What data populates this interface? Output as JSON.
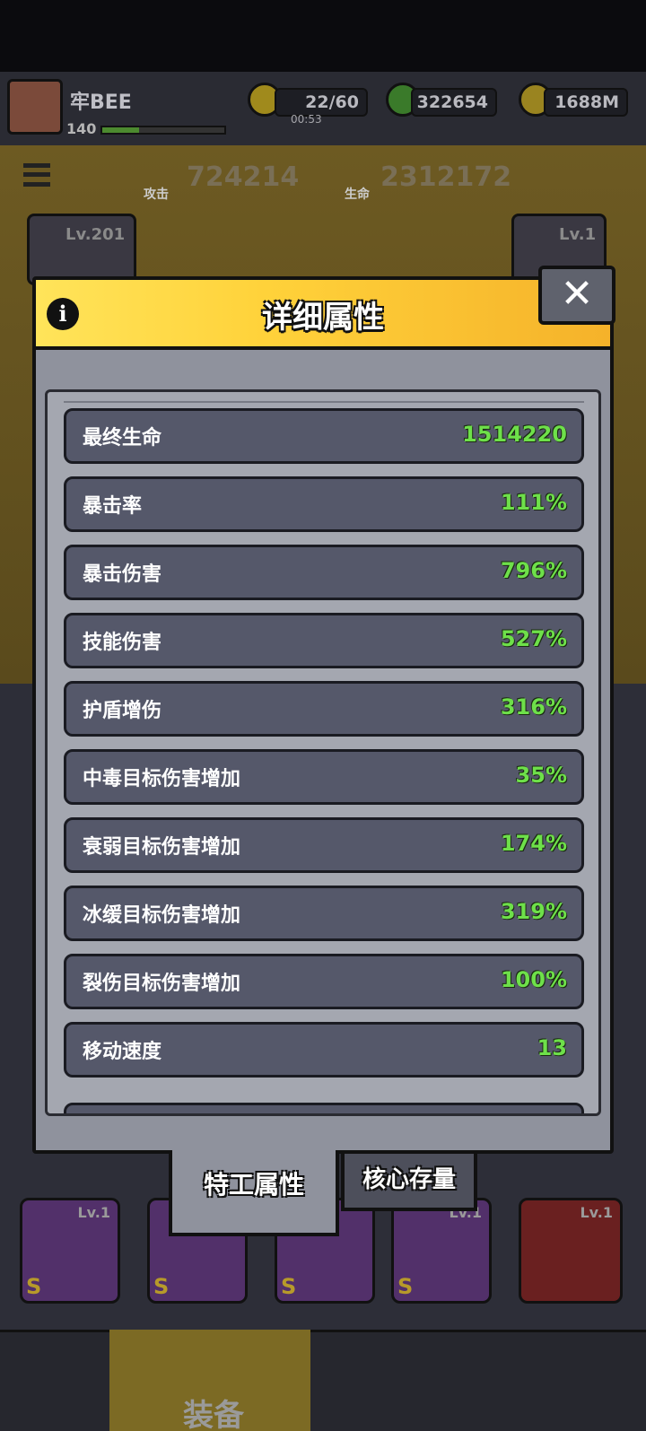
{
  "status": {
    "player_name": "牢BEE",
    "player_level": "140",
    "energy": "22/60",
    "energy_timer": "00:53",
    "gems": "322654",
    "gold": "1688M"
  },
  "power": {
    "attack_label": "攻击",
    "attack_value": "724214",
    "hp_label": "生命",
    "hp_value": "2312172"
  },
  "cards": {
    "left_lv": "Lv.201",
    "right_lv": "Lv.1"
  },
  "slots": [
    {
      "lv": "Lv.1",
      "grade": "S"
    },
    {
      "lv": "",
      "grade": "S"
    },
    {
      "lv": "",
      "grade": "S"
    },
    {
      "lv": "Lv.1",
      "grade": "S"
    },
    {
      "lv": "Lv.1",
      "grade": ""
    }
  ],
  "nav": {
    "active_label": "装备"
  },
  "modal": {
    "title": "详细属性",
    "close_glyph": "✕",
    "info_glyph": "i",
    "stats": [
      {
        "label": "最终生命",
        "value": "1514220"
      },
      {
        "label": "暴击率",
        "value": "111%"
      },
      {
        "label": "暴击伤害",
        "value": "796%"
      },
      {
        "label": "技能伤害",
        "value": "527%"
      },
      {
        "label": "护盾增伤",
        "value": "316%"
      },
      {
        "label": "中毒目标伤害增加",
        "value": "35%"
      },
      {
        "label": "衰弱目标伤害增加",
        "value": "174%"
      },
      {
        "label": "冰缓目标伤害增加",
        "value": "319%"
      },
      {
        "label": "裂伤目标伤害增加",
        "value": "100%"
      },
      {
        "label": "移动速度",
        "value": "13"
      }
    ],
    "tabs": {
      "active": "特工属性",
      "inactive": "核心存量"
    }
  },
  "colors": {
    "value_green": "#6ee04a",
    "header_yellow": "#ffd23a",
    "row_bg": "#55586a"
  }
}
